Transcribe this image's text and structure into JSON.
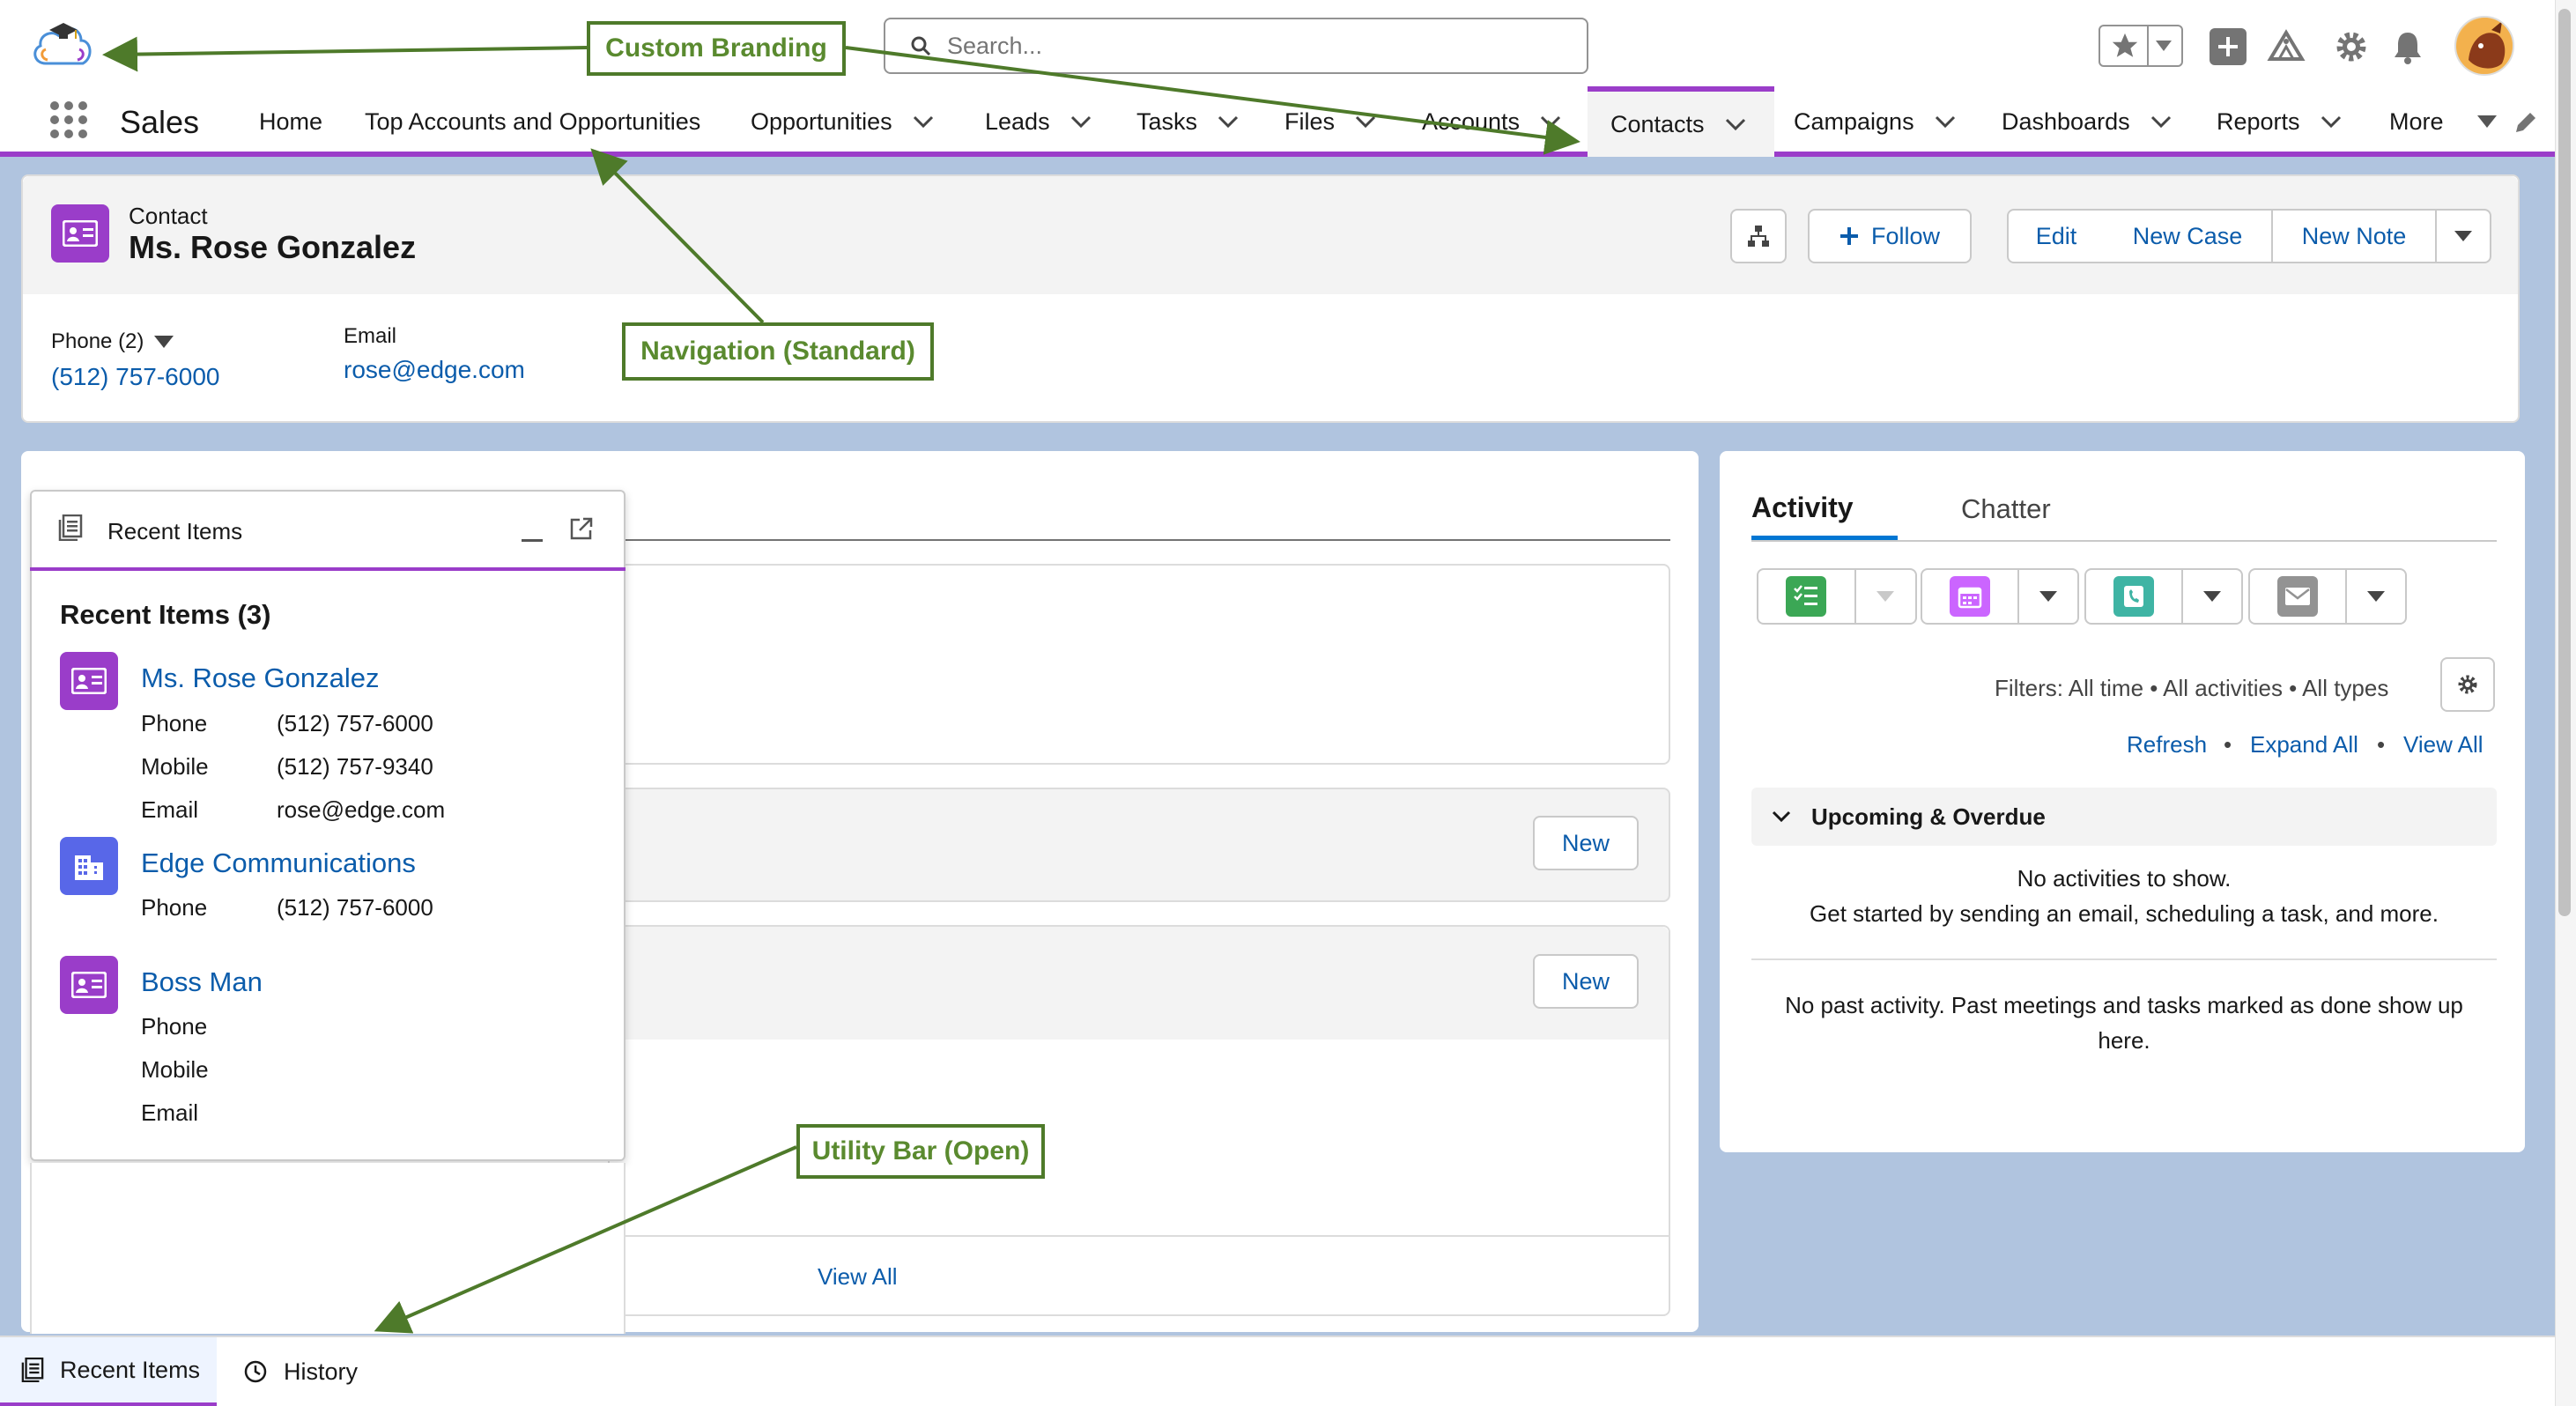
{
  "header": {
    "search_placeholder": "Search...",
    "avatar_alt": ""
  },
  "nav": {
    "app_name": "Sales",
    "items": [
      {
        "label": "Home",
        "dropdown": false
      },
      {
        "label": "Top Accounts and Opportunities",
        "dropdown": false
      },
      {
        "label": "Opportunities",
        "dropdown": true
      },
      {
        "label": "Leads",
        "dropdown": true
      },
      {
        "label": "Tasks",
        "dropdown": true
      },
      {
        "label": "Files",
        "dropdown": true
      },
      {
        "label": "Accounts",
        "dropdown": true
      },
      {
        "label": "Contacts",
        "dropdown": true,
        "active": true
      },
      {
        "label": "Campaigns",
        "dropdown": true
      },
      {
        "label": "Dashboards",
        "dropdown": true
      },
      {
        "label": "Reports",
        "dropdown": true
      },
      {
        "label": "More",
        "dropdown": true
      }
    ]
  },
  "record": {
    "object_label": "Contact",
    "name": "Ms. Rose Gonzalez",
    "follow_label": "Follow",
    "actions": [
      "Edit",
      "New Case",
      "New Note"
    ],
    "phone_label": "Phone (2)",
    "phone_value": "(512) 757-6000",
    "email_label": "Email",
    "email_value": "rose@edge.com"
  },
  "main": {
    "new_label_1": "New",
    "new_label_2": "New",
    "view_all": "View All"
  },
  "activity": {
    "tabs": [
      "Activity",
      "Chatter"
    ],
    "filters": "Filters: All time • All activities • All types",
    "links": [
      "Refresh",
      "Expand All",
      "View All"
    ],
    "section_title": "Upcoming & Overdue",
    "no_activities": "No activities to show.",
    "get_started": "Get started by sending an email, scheduling a task, and more.",
    "no_past_line1": "No past activity. Past meetings and tasks marked as done show up",
    "no_past_line2": "here."
  },
  "recent_panel": {
    "header": "Recent Items",
    "title": "Recent Items (3)",
    "items": [
      {
        "name": "Ms. Rose Gonzalez",
        "icon": "contact-icon",
        "color": "#9a3dc9",
        "fields": [
          {
            "label": "Phone",
            "value": "(512) 757-6000"
          },
          {
            "label": "Mobile",
            "value": "(512) 757-9340"
          },
          {
            "label": "Email",
            "value": "rose@edge.com"
          }
        ]
      },
      {
        "name": "Edge Communications",
        "icon": "account-icon",
        "color": "#5867e8",
        "fields": [
          {
            "label": "Phone",
            "value": "(512) 757-6000"
          }
        ]
      },
      {
        "name": "Boss Man",
        "icon": "contact-icon",
        "color": "#9a3dc9",
        "fields": [
          {
            "label": "Phone",
            "value": ""
          },
          {
            "label": "Mobile",
            "value": ""
          },
          {
            "label": "Email",
            "value": ""
          }
        ]
      }
    ]
  },
  "utility_bar": {
    "items": [
      "Recent Items",
      "History"
    ]
  },
  "annotations": {
    "custom_branding": "Custom Branding",
    "navigation": "Navigation (Standard)",
    "utility_bar": "Utility Bar (Open)"
  },
  "colors": {
    "accent": "#9a3dc9",
    "link": "#0b5cab",
    "annotation": "#5a8a2f",
    "task": "#3ba755",
    "event": "#cb65ff",
    "call": "#3fb4a4",
    "email": "#939393"
  }
}
